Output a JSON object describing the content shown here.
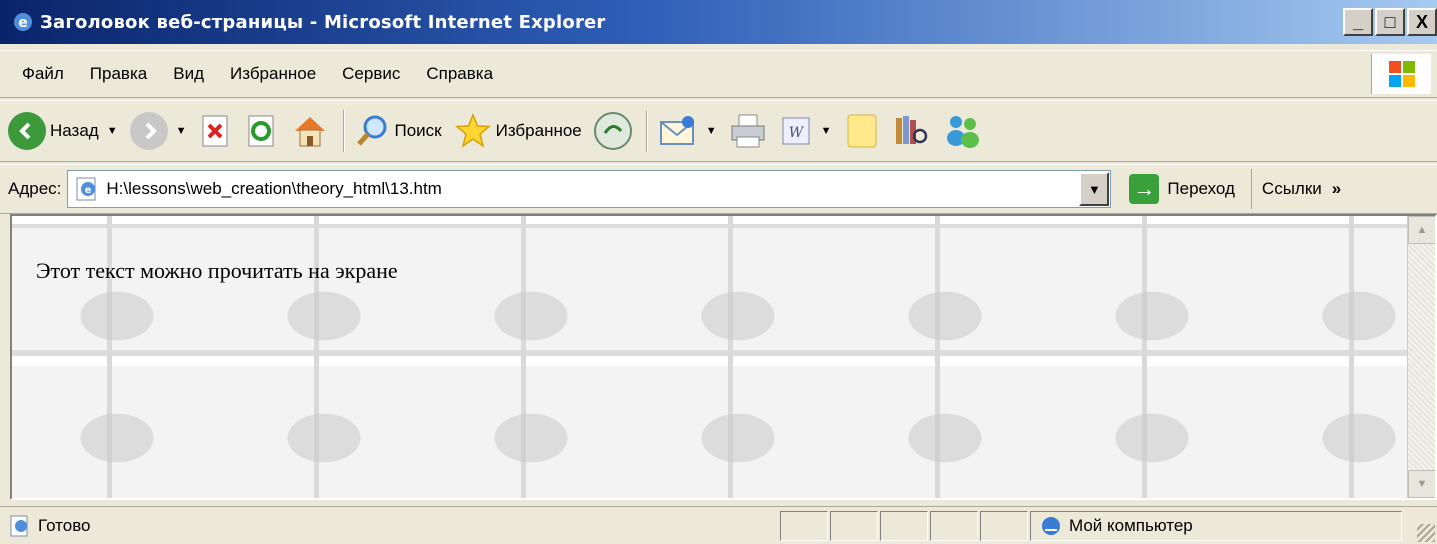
{
  "window": {
    "title": "Заголовок веб-страницы - Microsoft Internet Explorer",
    "minimize": "_",
    "maximize": "□",
    "close": "X"
  },
  "menu": {
    "items": [
      "Файл",
      "Правка",
      "Вид",
      "Избранное",
      "Сервис",
      "Справка"
    ]
  },
  "toolbar": {
    "back_label": "Назад",
    "search_label": "Поиск",
    "favorites_label": "Избранное"
  },
  "address": {
    "label": "Адрес:",
    "value": "H:\\lessons\\web_creation\\theory_html\\13.htm",
    "go_label": "Переход",
    "links_label": "Ссылки",
    "links_chevron": "»"
  },
  "page": {
    "text": "Этот текст можно прочитать на экране"
  },
  "status": {
    "text": "Готово",
    "zone": "Мой компьютер"
  },
  "colors": {
    "titlebar_start": "#0a246a",
    "titlebar_end": "#a6caf0",
    "chrome": "#ece9d8"
  }
}
